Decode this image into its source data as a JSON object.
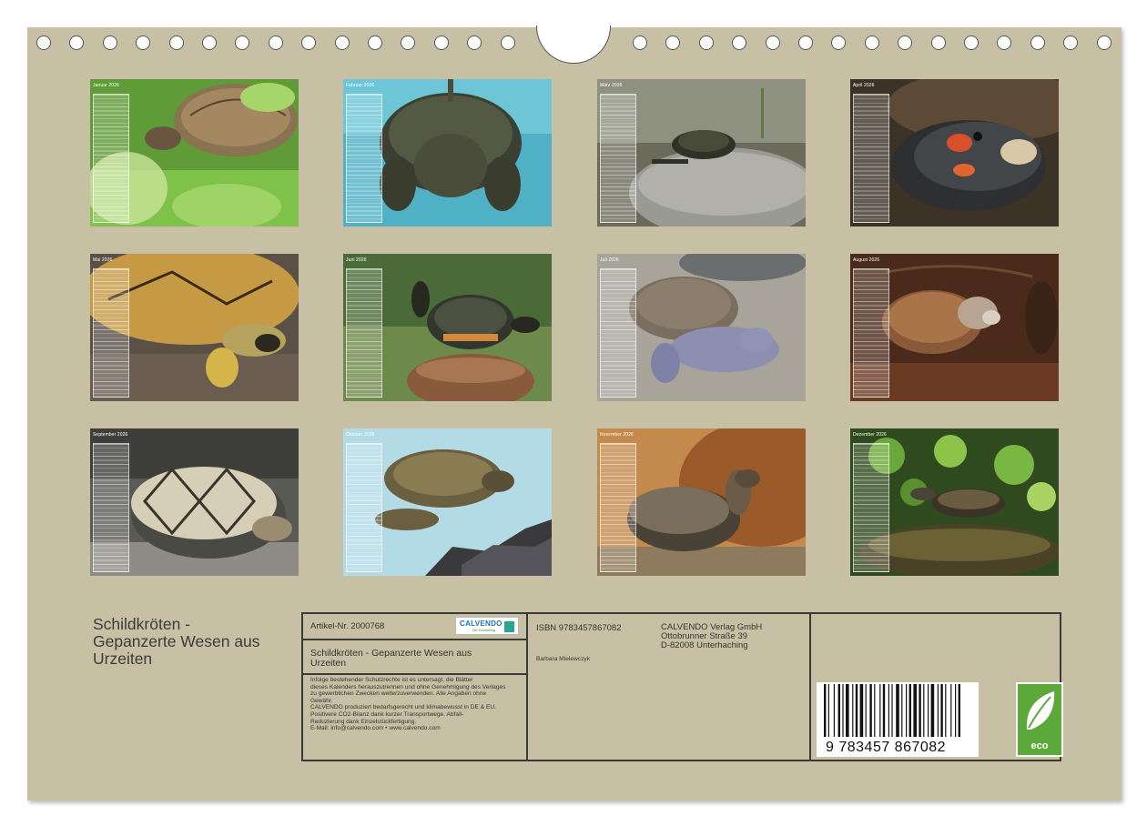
{
  "photos": [
    {
      "month": "Januar 2026"
    },
    {
      "month": "Februar 2026"
    },
    {
      "month": "März 2026"
    },
    {
      "month": "April 2026"
    },
    {
      "month": "Mai 2026"
    },
    {
      "month": "Juni 2026"
    },
    {
      "month": "Juli 2026"
    },
    {
      "month": "August 2026"
    },
    {
      "month": "September 2026"
    },
    {
      "month": "Oktober 2026"
    },
    {
      "month": "November 2026"
    },
    {
      "month": "Dezember 2026"
    }
  ],
  "title": {
    "line1": "Schildkröten -",
    "line2": "Gepanzerte Wesen aus",
    "line3": "Urzeiten"
  },
  "info": {
    "article": "Artikel-Nr. 2000768",
    "calvendo_logo": "CALVENDO",
    "calvendo_logo_sub": "Der Kunstverlag",
    "product_title_1": "Schildkröten - Gepanzerte Wesen aus",
    "product_title_2": "Urzeiten",
    "legal": [
      "Infolge bestehender Schutzrechte ist es untersagt, die Blätter",
      "dieses Kalenders herauszutrennen und ohne Genehmigung des Verlages",
      "zu gewerblichen Zwecken weiterzuverwenden. Alle Angaben ohne",
      "Gewähr.",
      "CALVENDO produziert bedarfsgerecht und klimabewusst in DE & EU.",
      "Positivere CO2-Bilanz dank kurzer Transportwege. Abfall-",
      "Reduzierung dank Einzelstückfertigung.",
      "E-Mail: info@calvendo.com • www.calvendo.com"
    ],
    "isbn": "ISBN 9783457867082",
    "author": "Barbara Mielewczyk",
    "publisher_1": "CALVENDO Verlag GmbH",
    "publisher_2": "Ottobrunner Straße 39",
    "publisher_3": "D-82008 Unterhaching",
    "barcode_number": "9  783457  867082",
    "eco_label": "eco"
  },
  "colors": {
    "sheet": "#c8c0a4",
    "border": "#3a3a3a",
    "eco_green": "#5da83a"
  }
}
